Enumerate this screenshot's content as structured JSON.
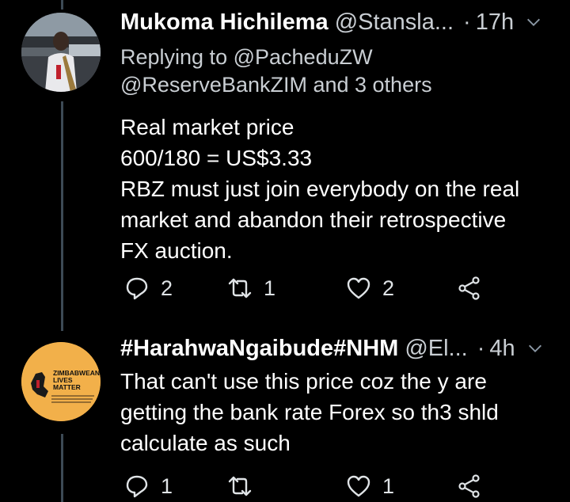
{
  "tweets": [
    {
      "name": "Mukoma Hichilema",
      "handle": "@Stansla...",
      "time": "17h",
      "reply_prefix": "Replying to",
      "reply_to": "@PacheduZW",
      "reply_others": "@ReserveBankZIM and 3 others",
      "lines": [
        "Real market price",
        "600/180 = US$3.33",
        "RBZ must just join everybody on the real",
        "market and abandon their retrospective",
        "FX auction."
      ],
      "replies": "2",
      "retweets": "1",
      "likes": "2"
    },
    {
      "name": "#HarahwaNgaibude#NHM",
      "handle": "@El...",
      "time": "4h",
      "avatar_text": [
        "ZIMBABWEAN",
        "LIVES",
        "MATTER"
      ],
      "lines": [
        "That can't use this price coz the y are",
        "getting the bank rate Forex so th3 shld",
        "calculate as such"
      ],
      "replies": "1",
      "retweets": "",
      "likes": "1"
    }
  ],
  "colors": {
    "background": "#000000",
    "text": "#ffffff",
    "secondary": "#c9ced3",
    "thread_line": "#3d4a55",
    "avatar2_bg": "#f2b04a"
  },
  "icons": [
    "reply-icon",
    "retweet-icon",
    "like-icon",
    "share-icon",
    "chevron-down-icon"
  ]
}
